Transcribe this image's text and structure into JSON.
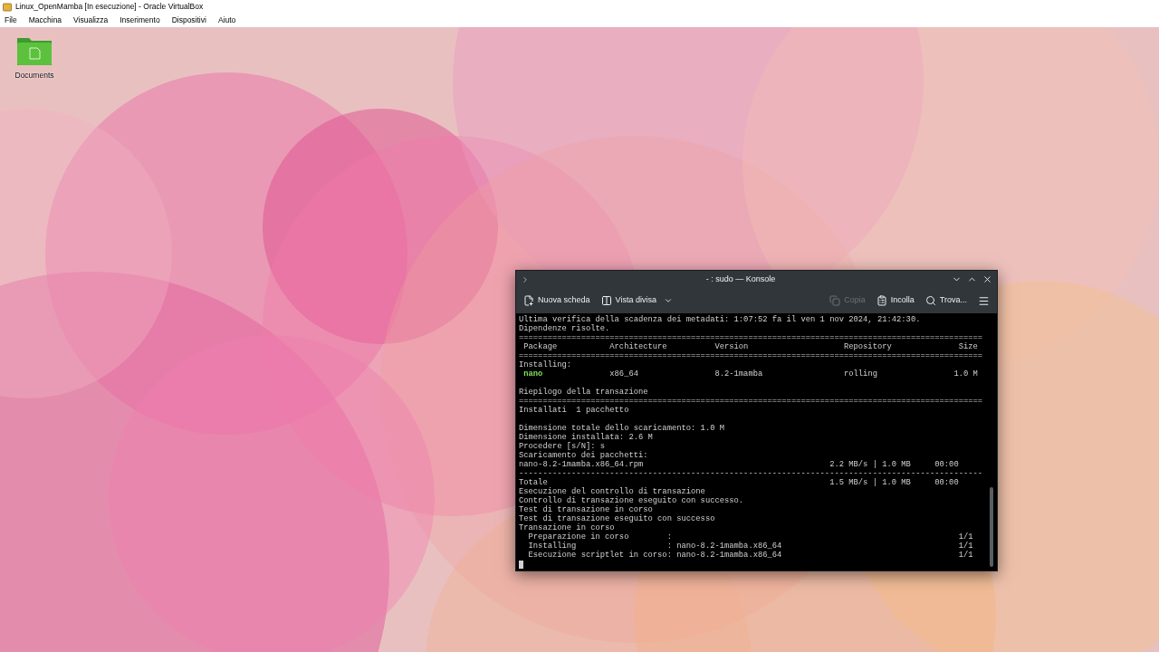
{
  "vbox": {
    "title": "Linux_OpenMamba [In esecuzione] - Oracle VirtualBox",
    "menu": [
      "File",
      "Macchina",
      "Visualizza",
      "Inserimento",
      "Dispositivi",
      "Aiuto"
    ]
  },
  "desktop": {
    "icons": [
      {
        "label": "Documents"
      }
    ]
  },
  "konsole": {
    "title": "- : sudo — Konsole",
    "toolbar": [
      {
        "kind": "new-tab",
        "label": "Nuova scheda",
        "disabled": false
      },
      {
        "kind": "split",
        "label": "Vista divisa",
        "disabled": false
      },
      {
        "kind": "copy",
        "label": "Copia",
        "disabled": true
      },
      {
        "kind": "paste",
        "label": "Incolla",
        "disabled": false
      },
      {
        "kind": "find",
        "label": "Trova...",
        "disabled": false
      }
    ],
    "lines": [
      {
        "text": "Ultima verifica della scadenza dei metadati: 1:07:52 fa il ven 1 nov 2024, 21:42:30."
      },
      {
        "text": "Dipendenze risolte."
      },
      {
        "text": "================================================================================================="
      },
      {
        "text": " Package           Architecture          Version                    Repository              Size"
      },
      {
        "text": "================================================================================================="
      },
      {
        "text": "Installing:"
      },
      {
        "kind": "package",
        "name": " nano",
        "text": "              x86_64                8.2-1mamba                 rolling                1.0 M"
      },
      {
        "kind": "blank"
      },
      {
        "text": "Riepilogo della transazione"
      },
      {
        "text": "================================================================================================="
      },
      {
        "text": "Installati  1 pacchetto"
      },
      {
        "kind": "blank"
      },
      {
        "text": "Dimensione totale dello scaricamento: 1.0 M"
      },
      {
        "text": "Dimensione installata: 2.6 M"
      },
      {
        "text": "Procedere [s/N]: s"
      },
      {
        "text": "Scaricamento dei pacchetti:"
      },
      {
        "text": "nano-8.2-1mamba.x86_64.rpm                                       2.2 MB/s | 1.0 MB     00:00"
      },
      {
        "text": "-------------------------------------------------------------------------------------------------"
      },
      {
        "text": "Totale                                                           1.5 MB/s | 1.0 MB     00:00"
      },
      {
        "text": "Esecuzione del controllo di transazione"
      },
      {
        "text": "Controllo di transazione eseguito con successo."
      },
      {
        "text": "Test di transazione in corso"
      },
      {
        "text": "Test di transazione eseguito con successo"
      },
      {
        "text": "Transazione in corso"
      },
      {
        "text": "  Preparazione in corso        :                                                            1/1"
      },
      {
        "text": "  Installing                   : nano-8.2-1mamba.x86_64                                     1/1"
      },
      {
        "text": "  Esecuzione scriptlet in corso: nano-8.2-1mamba.x86_64                                     1/1"
      },
      {
        "kind": "cursor"
      }
    ]
  }
}
